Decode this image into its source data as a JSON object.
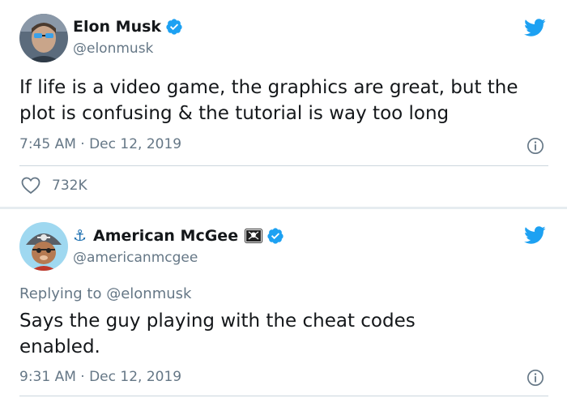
{
  "tweets": [
    {
      "name": "Elon Musk",
      "handle": "@elonmusk",
      "text": "If life is a video game, the graphics are great, but the plot is confusing & the tutorial is way too long",
      "timestamp": "7:45 AM · Dec 12, 2019",
      "likes": "732K",
      "verified": true
    },
    {
      "name": "American McGee",
      "name_prefix_emoji": "⚓",
      "name_suffix_emoji": "🏴‍☠️",
      "handle": "@americanmcgee",
      "replying_to_label": "Replying to",
      "replying_to_handle": "@elonmusk",
      "text": "Says the guy playing with the cheat codes enabled.",
      "timestamp": "9:31 AM · Dec 12, 2019",
      "verified": true
    }
  ],
  "colors": {
    "twitter_blue": "#1da1f2",
    "secondary_text": "#657786",
    "divider": "#ccd6dd"
  },
  "icons": [
    "twitter-bird-icon",
    "verified-badge-icon",
    "info-icon",
    "heart-icon",
    "anchor-emoji",
    "pirate-flag-emoji"
  ]
}
